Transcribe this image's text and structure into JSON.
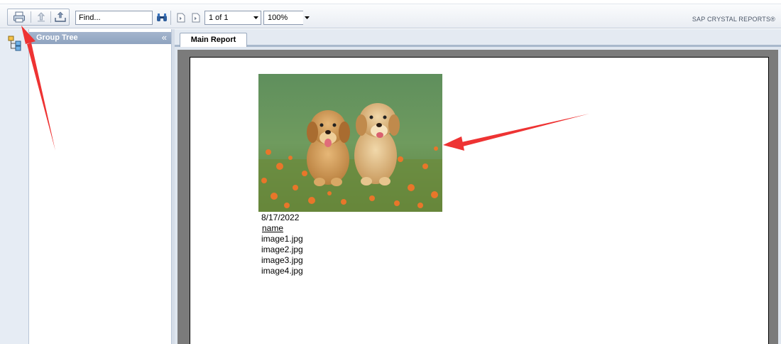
{
  "toolbar": {
    "buttons": {
      "print": "print-icon",
      "export": "export-icon",
      "upload": "upload-icon"
    },
    "find_placeholder": "Find...",
    "page_value": "1 of 1",
    "zoom_value": "100%",
    "brand": "SAP CRYSTAL REPORTS®"
  },
  "group_tree": {
    "title": "Group Tree",
    "collapse_glyph": "«"
  },
  "main": {
    "tab_label": "Main Report"
  },
  "report": {
    "date": "8/17/2022",
    "column_header": "name",
    "rows": [
      "image1.jpg",
      "image2.jpg",
      "image3.jpg",
      "image4.jpg"
    ]
  },
  "colors": {
    "annotation_arrow": "#ee3333",
    "group_tree_header": "#94a7c2"
  }
}
